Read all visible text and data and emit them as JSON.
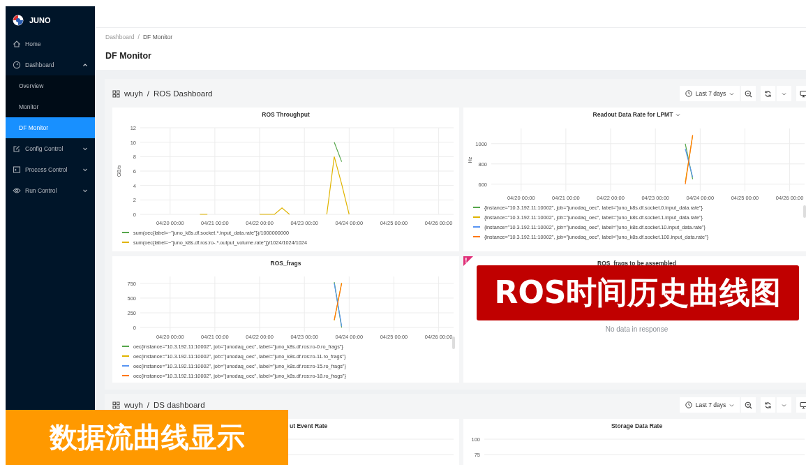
{
  "sidebar": {
    "logo": "JUNO",
    "items": [
      {
        "label": "Home",
        "selected": false
      },
      {
        "label": "Dashboard",
        "selected": false,
        "expanded": true,
        "children": [
          {
            "label": "Overview",
            "selected": false
          },
          {
            "label": "Monitor",
            "selected": false
          },
          {
            "label": "DF Monitor",
            "selected": true
          }
        ]
      },
      {
        "label": "Config Control",
        "selected": false,
        "expanded": false
      },
      {
        "label": "Process Control",
        "selected": false,
        "expanded": false
      },
      {
        "label": "Run Control",
        "selected": false,
        "expanded": false
      }
    ]
  },
  "header": {
    "breadcrumb": [
      "Dashboard",
      "DF Monitor"
    ],
    "separator": "/",
    "title": "DF Monitor"
  },
  "dashboards": [
    {
      "folder": "wuyh",
      "separator": "/",
      "title": "ROS Dashboard",
      "time_range": "Last 7 days",
      "panels": [
        {
          "title": "ROS Throughput",
          "chart_data": {
            "type": "line",
            "grid": true,
            "ylabel": "GB/s",
            "ylim": [
              0,
              12
            ],
            "yticks": [
              0,
              2,
              4,
              6,
              8,
              10,
              12
            ],
            "categories": [
              null,
              null,
              null,
              null,
              "04/20 00:00",
              null,
              null,
              null,
              null,
              null,
              "04/21 00:00",
              null,
              null,
              null,
              null,
              null,
              "04/22 00:00",
              null,
              null,
              null,
              null,
              null,
              "04/23 00:00",
              null,
              null,
              null,
              null,
              null,
              "04/24 00:00",
              null,
              null,
              null,
              null,
              null,
              "04/25 00:00",
              null,
              null,
              null,
              null,
              null,
              "04/26 00:00",
              null,
              null
            ],
            "series": [
              {
                "name": "sum(oec{label=~\"juno_k8s.df.socket.*.input_data.rate\"})/1000000000",
                "color": "#56a64b",
                "values": [
                  null,
                  null,
                  null,
                  null,
                  null,
                  null,
                  null,
                  null,
                  null,
                  null,
                  null,
                  null,
                  null,
                  null,
                  null,
                  null,
                  null,
                  null,
                  null,
                  null,
                  null,
                  null,
                  null,
                  null,
                  null,
                  null,
                  10,
                  7.3,
                  null,
                  null,
                  null,
                  null,
                  null,
                  null,
                  null,
                  null,
                  null,
                  null,
                  null,
                  null,
                  null,
                  null,
                  null
                ]
              },
              {
                "name": "sum(oec{label=~\"juno_k8s.df.ros:ro-.*.output_volume.rate\"})/1024/1024/1024",
                "color": "#e0b400",
                "values": [
                  null,
                  null,
                  null,
                  null,
                  null,
                  null,
                  null,
                  null,
                  0,
                  0,
                  null,
                  null,
                  null,
                  null,
                  null,
                  null,
                  0,
                  0,
                  0,
                  0.9,
                  0,
                  null,
                  null,
                  null,
                  null,
                  0,
                  8,
                  4.2,
                  0,
                  null,
                  null,
                  null,
                  null,
                  null,
                  null,
                  null,
                  null,
                  null,
                  null,
                  null,
                  null,
                  null,
                  null
                ]
              }
            ]
          }
        },
        {
          "title": "Readout Data Rate for LPMT",
          "title_menu": true,
          "chart_data": {
            "type": "line",
            "grid": true,
            "ylabel": "Hz",
            "ylim": [
              530,
              1150
            ],
            "yticks": [
              600,
              800,
              1000
            ],
            "categories": [
              null,
              null,
              null,
              null,
              "04/20 00:00",
              null,
              null,
              null,
              null,
              null,
              "04/21 00:00",
              null,
              null,
              null,
              null,
              null,
              "04/22 00:00",
              null,
              null,
              null,
              null,
              null,
              "04/23 00:00",
              null,
              null,
              null,
              null,
              null,
              "04/24 00:00",
              null,
              null,
              null,
              null,
              null,
              "04/25 00:00",
              null,
              null,
              null,
              null,
              null,
              "04/26 00:00",
              null,
              null
            ],
            "series": [
              {
                "name": "{instance=\"10.3.192.11:10002\", job=\"junodaq_oec\", label=\"juno_k8s.df.socket.0.input_data.rate\"}",
                "color": "#56a64b",
                "values": [
                  null,
                  null,
                  null,
                  null,
                  null,
                  null,
                  null,
                  null,
                  null,
                  null,
                  null,
                  null,
                  null,
                  null,
                  null,
                  null,
                  null,
                  null,
                  null,
                  null,
                  null,
                  null,
                  null,
                  null,
                  null,
                  null,
                  1000,
                  650,
                  null,
                  null,
                  null,
                  null,
                  null,
                  null,
                  null,
                  null,
                  null,
                  null,
                  null,
                  null,
                  null,
                  null,
                  null
                ]
              },
              {
                "name": "{instance=\"10.3.192.11:10002\", job=\"junodaq_oec\", label=\"juno_k8s.df.socket.1.input_data.rate\"}",
                "color": "#e0b400",
                "values": [
                  null,
                  null,
                  null,
                  null,
                  null,
                  null,
                  null,
                  null,
                  null,
                  null,
                  null,
                  null,
                  null,
                  null,
                  null,
                  null,
                  null,
                  null,
                  null,
                  null,
                  null,
                  null,
                  null,
                  null,
                  null,
                  null,
                  620,
                  1080,
                  null,
                  null,
                  null,
                  null,
                  null,
                  null,
                  null,
                  null,
                  null,
                  null,
                  null,
                  null,
                  null,
                  null,
                  null
                ]
              },
              {
                "name": "{instance=\"10.3.192.11:10002\", job=\"junodaq_oec\", label=\"juno_k8s.df.socket.10.input_data.rate\"}",
                "color": "#5794f2",
                "values": [
                  null,
                  null,
                  null,
                  null,
                  null,
                  null,
                  null,
                  null,
                  null,
                  null,
                  null,
                  null,
                  null,
                  null,
                  null,
                  null,
                  null,
                  null,
                  null,
                  null,
                  null,
                  null,
                  null,
                  null,
                  null,
                  null,
                  950,
                  670,
                  null,
                  null,
                  null,
                  null,
                  null,
                  null,
                  null,
                  null,
                  null,
                  null,
                  null,
                  null,
                  null,
                  null,
                  null
                ]
              },
              {
                "name": "{instance=\"10.3.192.11:10002\", job=\"junodaq_oec\", label=\"juno_k8s.df.socket.100.input_data.rate\"}",
                "color": "#ff780a",
                "values": [
                  null,
                  null,
                  null,
                  null,
                  null,
                  null,
                  null,
                  null,
                  null,
                  null,
                  null,
                  null,
                  null,
                  null,
                  null,
                  null,
                  null,
                  null,
                  null,
                  null,
                  null,
                  null,
                  null,
                  null,
                  null,
                  null,
                  600,
                  1085,
                  null,
                  null,
                  null,
                  null,
                  null,
                  null,
                  null,
                  null,
                  null,
                  null,
                  null,
                  null,
                  null,
                  null,
                  null
                ]
              }
            ]
          }
        },
        {
          "title": "ROS_frags",
          "chart_data": {
            "type": "line",
            "grid": true,
            "ylim": [
              -70,
              867
            ],
            "yticks": [
              0,
              250,
              500,
              750
            ],
            "categories": [
              null,
              null,
              null,
              null,
              "04/20 00:00",
              null,
              null,
              null,
              null,
              null,
              "04/21 00:00",
              null,
              null,
              null,
              null,
              null,
              "04/22 00:00",
              null,
              null,
              null,
              null,
              null,
              "04/23 00:00",
              null,
              null,
              null,
              null,
              null,
              "04/24 00:00",
              null,
              null,
              null,
              null,
              null,
              "04/25 00:00",
              null,
              null,
              null,
              null,
              null,
              "04/26 00:00",
              null,
              null
            ],
            "series": [
              {
                "name": "oec{instance=\"10.3.192.11:10002\", job=\"junodaq_oec\", label=\"juno_k8s.df.ros:ro-0.ro_frags\"}",
                "color": "#56a64b",
                "values": [
                  null,
                  null,
                  null,
                  null,
                  null,
                  null,
                  null,
                  null,
                  null,
                  null,
                  null,
                  null,
                  null,
                  null,
                  null,
                  null,
                  null,
                  null,
                  null,
                  null,
                  null,
                  null,
                  null,
                  null,
                  null,
                  null,
                  770,
                  0,
                  null,
                  null,
                  null,
                  null,
                  null,
                  null,
                  null,
                  null,
                  null,
                  null,
                  null,
                  null,
                  null,
                  null,
                  null
                ]
              },
              {
                "name": "oec{instance=\"10.3.192.11:10002\", job=\"junodaq_oec\", label=\"juno_k8s.df.ros:ro-11.ro_frags\"}",
                "color": "#e0b400",
                "values": [
                  null,
                  null,
                  null,
                  null,
                  null,
                  null,
                  null,
                  null,
                  null,
                  null,
                  null,
                  null,
                  null,
                  null,
                  null,
                  null,
                  null,
                  null,
                  null,
                  null,
                  null,
                  null,
                  null,
                  null,
                  null,
                  null,
                  120,
                  760,
                  null,
                  null,
                  null,
                  null,
                  null,
                  null,
                  null,
                  null,
                  null,
                  null,
                  null,
                  null,
                  null,
                  null,
                  null
                ]
              },
              {
                "name": "oec{instance=\"10.3.192.11:10002\", job=\"junodaq_oec\", label=\"juno_k8s.df.ros:ro-15.ro_frags\"}",
                "color": "#5794f2",
                "values": [
                  null,
                  null,
                  null,
                  null,
                  null,
                  null,
                  null,
                  null,
                  null,
                  null,
                  null,
                  null,
                  null,
                  null,
                  null,
                  null,
                  null,
                  null,
                  null,
                  null,
                  null,
                  null,
                  null,
                  null,
                  null,
                  null,
                  750,
                  20,
                  null,
                  null,
                  null,
                  null,
                  null,
                  null,
                  null,
                  null,
                  null,
                  null,
                  null,
                  null,
                  null,
                  null,
                  null
                ]
              },
              {
                "name": "oec{instance=\"10.3.192.11:10002\", job=\"junodaq_oec\", label=\"juno_k8s.df.ros:ro-18.ro_frags\"}",
                "color": "#ff780a",
                "values": [
                  null,
                  null,
                  null,
                  null,
                  null,
                  null,
                  null,
                  null,
                  null,
                  null,
                  null,
                  null,
                  null,
                  null,
                  null,
                  null,
                  null,
                  null,
                  null,
                  null,
                  null,
                  null,
                  null,
                  null,
                  null,
                  null,
                  130,
                  750,
                  null,
                  null,
                  null,
                  null,
                  null,
                  null,
                  null,
                  null,
                  null,
                  null,
                  null,
                  null,
                  null,
                  null,
                  null
                ]
              }
            ]
          }
        },
        {
          "title": "ROS_frags to be assembled",
          "error": true,
          "message": "No data in response"
        }
      ]
    },
    {
      "folder": "wuyh",
      "separator": "/",
      "title": "DS dashboard",
      "time_range": "Last 7 days",
      "panels": [
        {
          "title": "ut Event Rate"
        },
        {
          "title": "Storage Data Rate",
          "y_tick_labels": [
            "100",
            "75"
          ]
        }
      ]
    }
  ],
  "annotations": [
    {
      "text": "ROS时间历史曲线图",
      "color": "#c00000"
    },
    {
      "text": "数据流曲线显示",
      "color": "#ff9900"
    }
  ]
}
